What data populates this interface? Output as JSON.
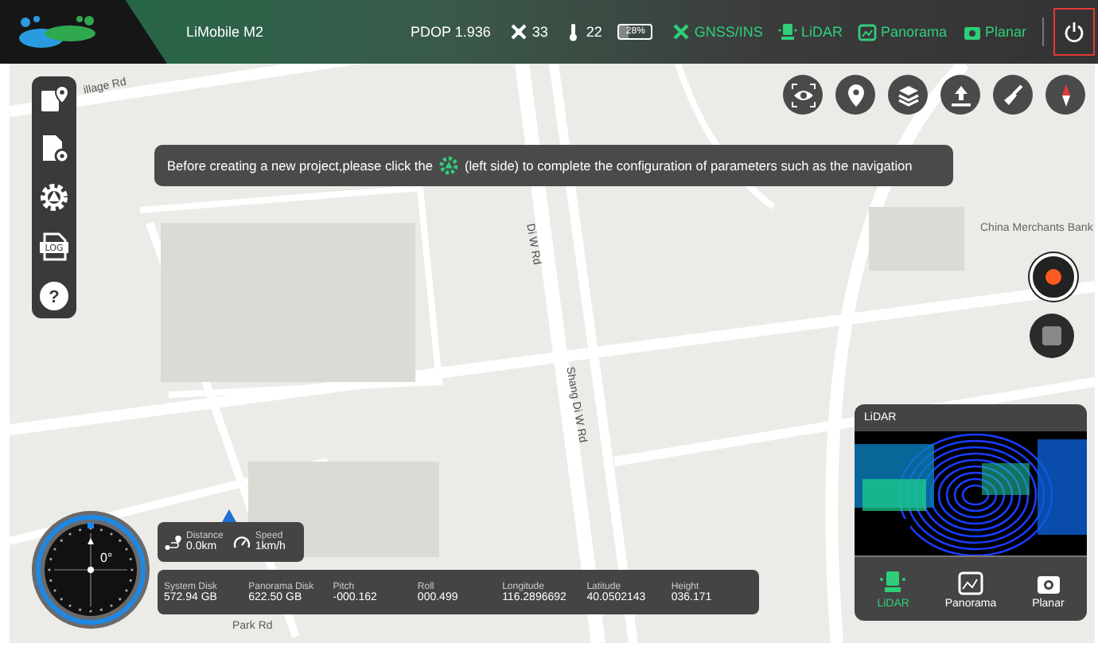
{
  "top_bar": {
    "device": "LiMobile M2",
    "pdop": "PDOP 1.936",
    "satellites": "33",
    "temperature": "22",
    "battery": {
      "label": "28%",
      "level": 0.28
    },
    "sensors": [
      {
        "kind": "gnss",
        "label": "GNSS/INS"
      },
      {
        "kind": "lidar",
        "label": "LiDAR"
      },
      {
        "kind": "panorama",
        "label": "Panorama"
      },
      {
        "kind": "planar",
        "label": "Planar"
      }
    ],
    "power_highlighted": true
  },
  "left_toolbar": [
    {
      "kind": "map"
    },
    {
      "kind": "file-settings"
    },
    {
      "kind": "settings"
    },
    {
      "kind": "log",
      "text": "LOG"
    },
    {
      "kind": "help",
      "text": "?"
    }
  ],
  "notice": {
    "text_before": "Before creating a new project,please click the",
    "text_after": "(left side) to complete the configuration of parameters such as the navigation"
  },
  "map_labels": [
    {
      "kind": "road",
      "text": "illage Rd"
    },
    {
      "kind": "road-vertical",
      "text": "Di W Rd"
    },
    {
      "kind": "road-vertical",
      "text": "Shang Di W Rd"
    },
    {
      "kind": "road-diag",
      "text": "Park Rd"
    },
    {
      "kind": "poi",
      "text": "China Merchants Bank"
    }
  ],
  "lidar_panel": {
    "title": "LiDAR",
    "tabs": [
      {
        "kind": "lidar",
        "label": "LiDAR",
        "selected": true
      },
      {
        "kind": "panorama",
        "label": "Panorama",
        "selected": false
      },
      {
        "kind": "planar",
        "label": "Planar",
        "selected": false
      }
    ]
  },
  "compass": {
    "heading": "0°"
  },
  "motion": [
    {
      "kind": "distance",
      "label": "Distance",
      "value": "0.0km"
    },
    {
      "kind": "speed",
      "label": "Speed",
      "value": "1km/h"
    }
  ],
  "readouts": [
    {
      "label": "System Disk",
      "value": "572.94 GB"
    },
    {
      "label": "Panorama Disk",
      "value": "622.50 GB"
    },
    {
      "label": "Pitch",
      "value": "-000.162"
    },
    {
      "label": "Roll",
      "value": "000.499"
    },
    {
      "label": "Longitude",
      "value": "116.2896692"
    },
    {
      "label": "Latitude",
      "value": "40.0502143"
    },
    {
      "label": "Height",
      "value": "036.171"
    }
  ]
}
